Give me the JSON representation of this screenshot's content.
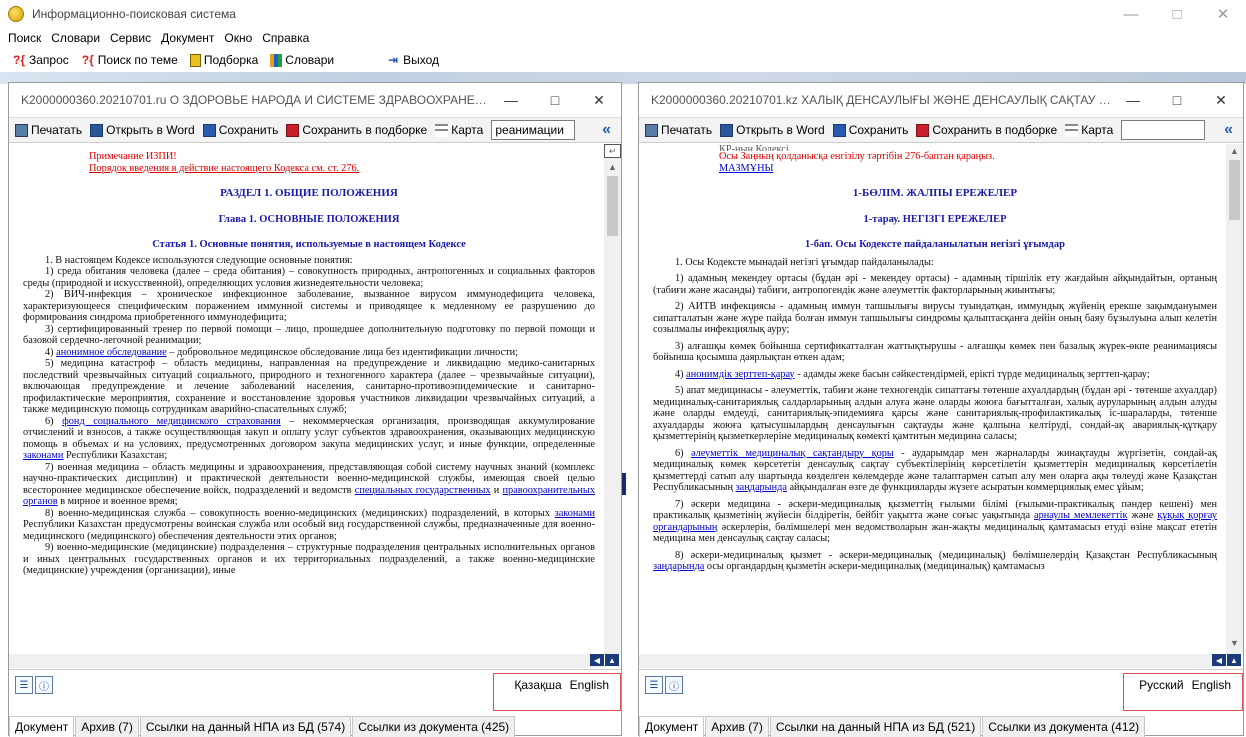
{
  "app": {
    "title": "Информационно-поисковая система",
    "window_controls": {
      "minimize": "—",
      "maximize": "□",
      "close": "✕"
    }
  },
  "menu": [
    "Поиск",
    "Словари",
    "Сервис",
    "Документ",
    "Окно",
    "Справка"
  ],
  "toolbar": {
    "query": "Запрос",
    "theme_search": "Поиск по теме",
    "selection": "Подборка",
    "dictionaries": "Словари",
    "exit": "Выход"
  },
  "left": {
    "title": "K2000000360.20210701.ru  О ЗДОРОВЬЕ НАРОДА И СИСТЕМЕ ЗДРАВООХРАНЕНИ...",
    "controls": {
      "minimize": "—",
      "maximize": "□",
      "close": "✕"
    },
    "toolbar": {
      "print": "Печатать",
      "word": "Открыть в Word",
      "save": "Сохранить",
      "save_sel": "Сохранить в подборке",
      "map": "Карта",
      "search_value": "реанимации"
    },
    "doc": {
      "note": "Примечание ИЗПИ!",
      "note2": "Порядок введения в действие настоящего Кодекса см. ст. 276.",
      "h1": "РАЗДЕЛ 1. ОБЩИЕ ПОЛОЖЕНИЯ",
      "h2": "Глава 1. ОСНОВНЫЕ ПОЛОЖЕНИЯ",
      "h3": "Статья 1. Основные понятия, используемые в настоящем Кодексе",
      "p0": "1. В настоящем Кодексе используются следующие основные понятия:",
      "p1": "1) среда обитания человека (далее – среда обитания) – совокупность природных, антропогенных и социальных факторов среды (природной и искусственной), определяющих условия жизнедеятельности человека;",
      "p2": "2) ВИЧ-инфекция – хроническое инфекционное заболевание, вызванное вирусом иммунодефицита человека, характеризующееся специфическим поражением иммунной системы и приводящее к медленному ее разрушению до формирования синдрома приобретенного иммунодефицита;",
      "p3": "3) сертифицированный тренер по первой помощи – лицо, прошедшее дополнительную подготовку по первой помощи и базовой сердечно-легочной реанимации;",
      "p4_link": "анонимное обследование",
      "p4": " – добровольное медицинское обследование лица без идентификации личности;",
      "p5": "5) медицина катастроф – область медицины, направленная на предупреждение и ликвидацию медико-санитарных последствий чрезвычайных ситуаций социального, природного и техногенного характера (далее – чрезвычайные ситуации), включающая предупреждение и лечение заболеваний населения, санитарно-противоэпидемические и санитарно-профилактические мероприятия, сохранение и восстановление здоровья участников ликвидации чрезвычайных ситуаций, а также медицинскую помощь сотрудникам аварийно-спасательных служб;",
      "p6_link": "фонд социального медицинского страхования",
      "p6": " – некоммерческая организация, производящая аккумулирование отчислений и взносов, а также осуществляющая закуп и оплату услуг субъектов здравоохранения, оказывающих медицинскую помощь в объемах и на условиях, предусмотренных договором закупа медицинских услуг, и иные функции, определенные ",
      "p6_link2": "законами",
      "p6_end": " Республики Казахстан;",
      "p7": "7) военная медицина – область медицины и здравоохранения, представляющая собой систему научных знаний (комплекс научно-практических дисциплин) и практической деятельности военно-медицинской службы, имеющая своей целью всестороннее медицинское обеспечение войск, подразделений и ведомств ",
      "p7_link": "специальных государственных",
      "p7_mid": " и ",
      "p7_link2": "правоохранительных органов",
      "p7_end": " в мирное и военное время;",
      "p8": "8) военно-медицинская служба – совокупность военно-медицинских (медицинских) подразделений, в которых ",
      "p8_link": "законами",
      "p8_end": " Республики Казахстан предусмотрены воинская служба или особый вид государственной службы, предназначенные для военно-медицинского (медицинского) обеспечения деятельности этих органов;",
      "p9": "9) военно-медицинские (медицинские) подразделения – структурные подразделения центральных исполнительных органов и иных центральных государственных органов и их территориальных подразделений, а также военно-медицинские (медицинские) учреждения (организации), иные"
    },
    "langs": [
      "Қазақша",
      "English"
    ],
    "tabs": [
      "Документ",
      "Архив (7)",
      "Ссылки на данный НПА из БД (574)",
      "Ссылки из документа (425)"
    ]
  },
  "right": {
    "title": "K2000000360.20210701.kz  ХАЛЫҚ ДЕНСАУЛЫҒЫ ЖӘНЕ ДЕНСАУЛЫҚ САҚТАУ ЖҮЙ...",
    "controls": {
      "minimize": "—",
      "maximize": "□",
      "close": "✕"
    },
    "toolbar": {
      "print": "Печатать",
      "word": "Открыть в Word",
      "save": "Сохранить",
      "save_sel": "Сохранить в подборке",
      "map": "Карта",
      "search_value": ""
    },
    "doc": {
      "top": "ҚР-ның Кодексі.",
      "note": "Осы Заңның қолданысқа енгізілу тәртібін 276-баптан қараңыз.",
      "toc": "МАЗМҰНЫ",
      "h1": "1-БӨЛІМ. ЖАЛПЫ ЕРЕЖЕЛЕР",
      "h2": "1-тарау. НЕГІЗГІ ЕРЕЖЕЛЕР",
      "h3": "1-бап. Осы Кодексте пайдаланылатын негізгі ұғымдар",
      "p0": "1. Осы Кодексте мынадай негізгі ұғымдар пайдаланылады:",
      "p1": "1) адамның мекендеу ортасы (бұдан әрі - мекендеу ортасы) - адамның тіршілік ету жағдайын айқындайтын, ортаның (табиғи және жасанды) табиғи, антропогендік және әлеуметтік факторларының жиынтығы;",
      "p2": "2) АИТВ инфекциясы - адамның иммун тапшылығы вирусы туындатқан, иммундық жүйенің ерекше зақымдануымен сипатталатын және жүре пайда болған иммун тапшылығы синдромы қалыптасқанға дейін оның баяу бұзылуына алып келетін созылмалы инфекциялық ауру;",
      "p3": "3) алғашқы көмек бойынша сертификатталған жаттықтырушы - алғашқы көмек пен базалық жүрек-өкпе реанимациясы бойынша қосымша даярлықтан өткен адам;",
      "p4_link": "анонимдік зерттеп-қарау",
      "p4": " - адамды жеке басын сәйкестендірмей, ерікті түрде медициналық зерттеп-қарау;",
      "p5": "5) апат медицинасы - әлеуметтік, табиғи және техногендік сипаттағы төтенше ахуалдардың (бұдан әрі - төтенше ахуалдар) медициналық-санитариялық салдарларының алдын алуға және оларды жоюға бағытталған, халық ауруларының алдын алуды және оларды емдеуді, санитариялық-эпидемияға қарсы және санитариялық-профилактикалық іс-шараларды, төтенше ахуалдарды жоюға қатысушылардың денсаулығын сақтауды және қалпына келтіруді, сондай-ақ авариялық-құтқару қызметтерінің қызметкерлеріне медициналық көмекті қамтитын медицина саласы;",
      "p6_link": "әлеуметтік медициналық сақтандыру қоры",
      "p6": " - аударымдар мен жарналарды жинақтауды жүргізетін, сондай-ақ медициналық көмек көрсететін денсаулық сақтау субъектілерінің көрсетілетін қызметтерін медициналық көрсетілетін қызметтерді сатып алу шартында көзделген көлемдерде және талаптармен сатып алу мен оларға ақы төлеуді және Қазақстан Республикасының ",
      "p6_link2": "заңдарында",
      "p6_end": " айқындалған өзге де функцияларды жүзеге асыратын коммерциялық емес ұйым;",
      "p7": "7) әскери медицина - әскери-медициналық қызметтің ғылыми білімі (ғылыми-практикалық пәндер кешені) мен практикалық қызметінің жүйесін білдіретін, бейбіт уақытта және соғыс уақытында ",
      "p7_link": "арнаулы мемлекеттік",
      "p7_mid": " және ",
      "p7_link2": "құқық қорғау органдарының",
      "p7_end": " әскерлерін, бөлімшелері мен ведомстволарын жан-жақты медициналық қамтамасыз етуді өзіне мақсат ететін медицина мен денсаулық сақтау саласы;",
      "p8": "8) әскери-медициналық қызмет - әскери-медициналық (медициналық) бөлімшелердің Қазақстан Республикасының ",
      "p8_link": "заңдарында",
      "p8_end": " осы органдардың қызметін әскери-медициналық (медициналық) қамтамасыз"
    },
    "langs": [
      "Русский",
      "English"
    ],
    "tabs": [
      "Документ",
      "Архив (7)",
      "Ссылки на данный НПА из БД (521)",
      "Ссылки из документа (412)"
    ]
  }
}
